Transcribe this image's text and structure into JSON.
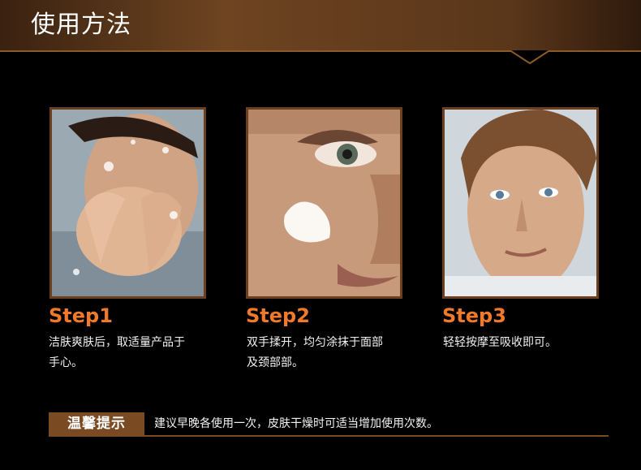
{
  "header": {
    "title": "使用方法"
  },
  "steps": [
    {
      "title": "Step1",
      "lines": [
        "洁肤爽肤后，取适量产品于",
        "手心。"
      ],
      "photo_icon": "face-washing-photo"
    },
    {
      "title": "Step2",
      "lines": [
        "双手揉开，均匀涂抹于面部",
        "及颈部部。"
      ],
      "photo_icon": "cream-applied-photo"
    },
    {
      "title": "Step3",
      "lines": [
        "轻轻按摩至吸收即可。"
      ],
      "photo_icon": "clean-face-photo"
    }
  ],
  "tip": {
    "label": "温馨提示",
    "text": "建议早晚各使用一次，皮肤干燥时可适当增加使用次数。"
  },
  "colors": {
    "accent": "#f07a2a",
    "brown": "#7a4a22",
    "background": "#000000"
  }
}
